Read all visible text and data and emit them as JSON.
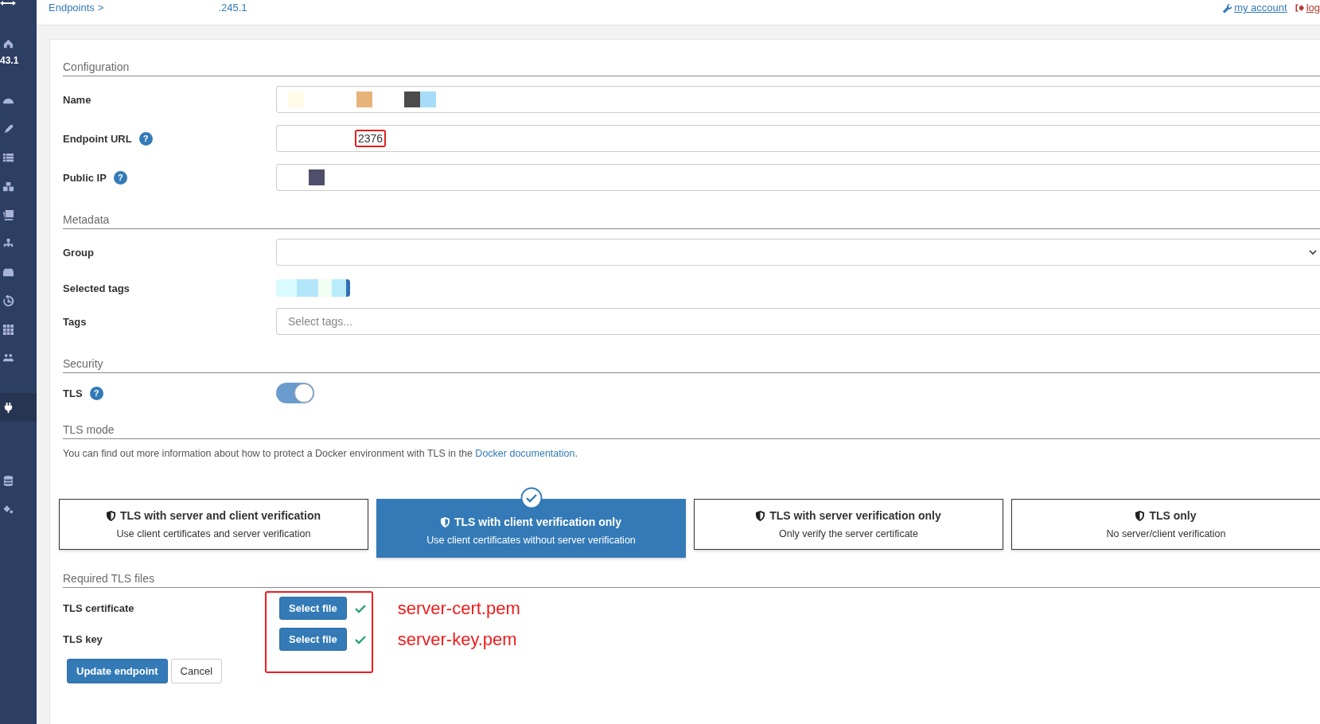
{
  "sidebar": {
    "environment_label": "43.1",
    "items": [
      {
        "selected": false
      },
      {
        "selected": false
      },
      {
        "selected": false
      },
      {
        "selected": false
      },
      {
        "selected": false
      },
      {
        "selected": false
      },
      {
        "selected": false
      },
      {
        "selected": false
      },
      {
        "selected": false
      },
      {
        "selected": false
      },
      {
        "selected": false
      },
      {
        "selected": true
      },
      {
        "selected": false
      },
      {
        "selected": false
      }
    ]
  },
  "topbar": {
    "breadcrumb": {
      "parent": "Endpoints",
      "separator": ">",
      "current": ".245.1"
    },
    "links": [
      "my account",
      "log"
    ]
  },
  "configuration": {
    "title": "Configuration",
    "name": {
      "label": "Name"
    },
    "endpoint_url": {
      "label": "Endpoint URL",
      "help": "?",
      "value": "2376",
      "annotated": true
    },
    "public_ip": {
      "label": "Public IP",
      "help": "?"
    }
  },
  "metadata": {
    "title": "Metadata",
    "group": {
      "label": "Group"
    },
    "selected_tags": {
      "label": "Selected tags"
    },
    "tags": {
      "label": "Tags",
      "placeholder": "Select tags..."
    }
  },
  "security": {
    "title": "Security",
    "tls": {
      "label": "TLS",
      "help": "?",
      "on": true
    }
  },
  "tls_mode": {
    "title": "TLS mode",
    "text_before": "You can find out more information about how to protect a Docker environment with TLS in the ",
    "link": "Docker documentation",
    "text_after": ".",
    "modes": [
      {
        "title": "TLS with server and client verification",
        "description": "Use client certificates and server verification",
        "selected": false
      },
      {
        "title": "TLS with client verification only",
        "description": "Use client certificates without server verification",
        "selected": true
      },
      {
        "title": "TLS with server verification only",
        "description": "Only verify the server certificate",
        "selected": false
      },
      {
        "title": "TLS only",
        "description": "No server/client verification",
        "selected": false
      }
    ]
  },
  "tls_files": {
    "title": "Required TLS files",
    "annotated": true,
    "files": [
      {
        "label": "TLS certificate",
        "button": "Select file",
        "uploaded": true,
        "annotation": "server-cert.pem"
      },
      {
        "label": "TLS key",
        "button": "Select file",
        "uploaded": true,
        "annotation": "server-key.pem"
      }
    ]
  },
  "actions": {
    "primary": "Update endpoint",
    "secondary": "Cancel"
  }
}
